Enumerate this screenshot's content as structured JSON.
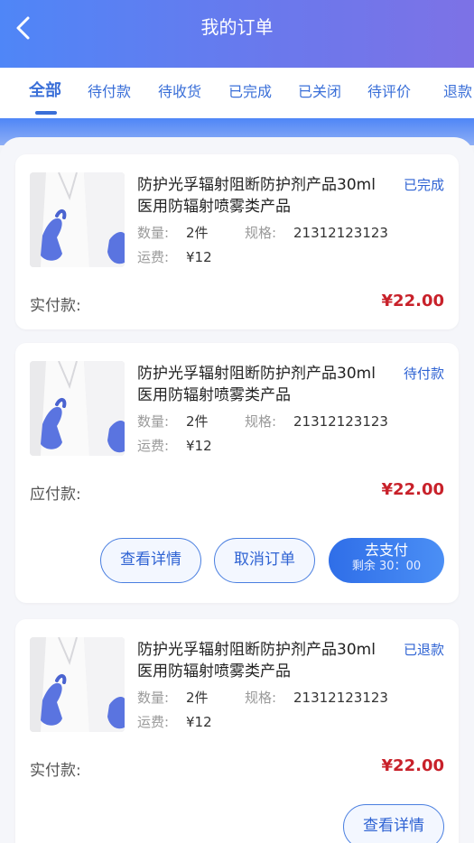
{
  "colors": {
    "accent": "#2f63d3",
    "price": "#c8212a",
    "header_start": "#4f86f7",
    "header_end": "#7d72e6"
  },
  "header": {
    "title": "我的订单",
    "back_icon": "chevron-left-icon"
  },
  "tabs": [
    {
      "label": "全部",
      "active": true
    },
    {
      "label": "待付款"
    },
    {
      "label": "待收货"
    },
    {
      "label": "已完成"
    },
    {
      "label": "已关闭"
    },
    {
      "label": "待评价"
    },
    {
      "label": "退款"
    }
  ],
  "orders": [
    {
      "product_name": "防护光孚辐射阻断防护剂产品30ml医用防辐射喷雾类产品",
      "status": "已完成",
      "qty_label": "数量:",
      "qty_value": "2件",
      "spec_label": "规格:",
      "spec_value": "21312123123",
      "freight_label": "运费:",
      "freight_value": "¥12",
      "pay_label": "实付款:",
      "pay_amount": "¥22.00"
    },
    {
      "product_name": "防护光孚辐射阻断防护剂产品30ml医用防辐射喷雾类产品",
      "status": "待付款",
      "qty_label": "数量:",
      "qty_value": "2件",
      "spec_label": "规格:",
      "spec_value": "21312123123",
      "freight_label": "运费:",
      "freight_value": "¥12",
      "pay_label": "应付款:",
      "pay_amount": "¥22.00",
      "buttons": {
        "detail": "查看详情",
        "cancel": "取消订单",
        "pay": "去支付",
        "remaining": "剩余 30：00"
      }
    },
    {
      "product_name": "防护光孚辐射阻断防护剂产品30ml医用防辐射喷雾类产品",
      "status": "已退款",
      "qty_label": "数量:",
      "qty_value": "2件",
      "spec_label": "规格:",
      "spec_value": "21312123123",
      "freight_label": "运费:",
      "freight_value": "¥12",
      "pay_label": "实付款:",
      "pay_amount": "¥22.00",
      "buttons": {
        "detail": "查看详情"
      }
    }
  ]
}
